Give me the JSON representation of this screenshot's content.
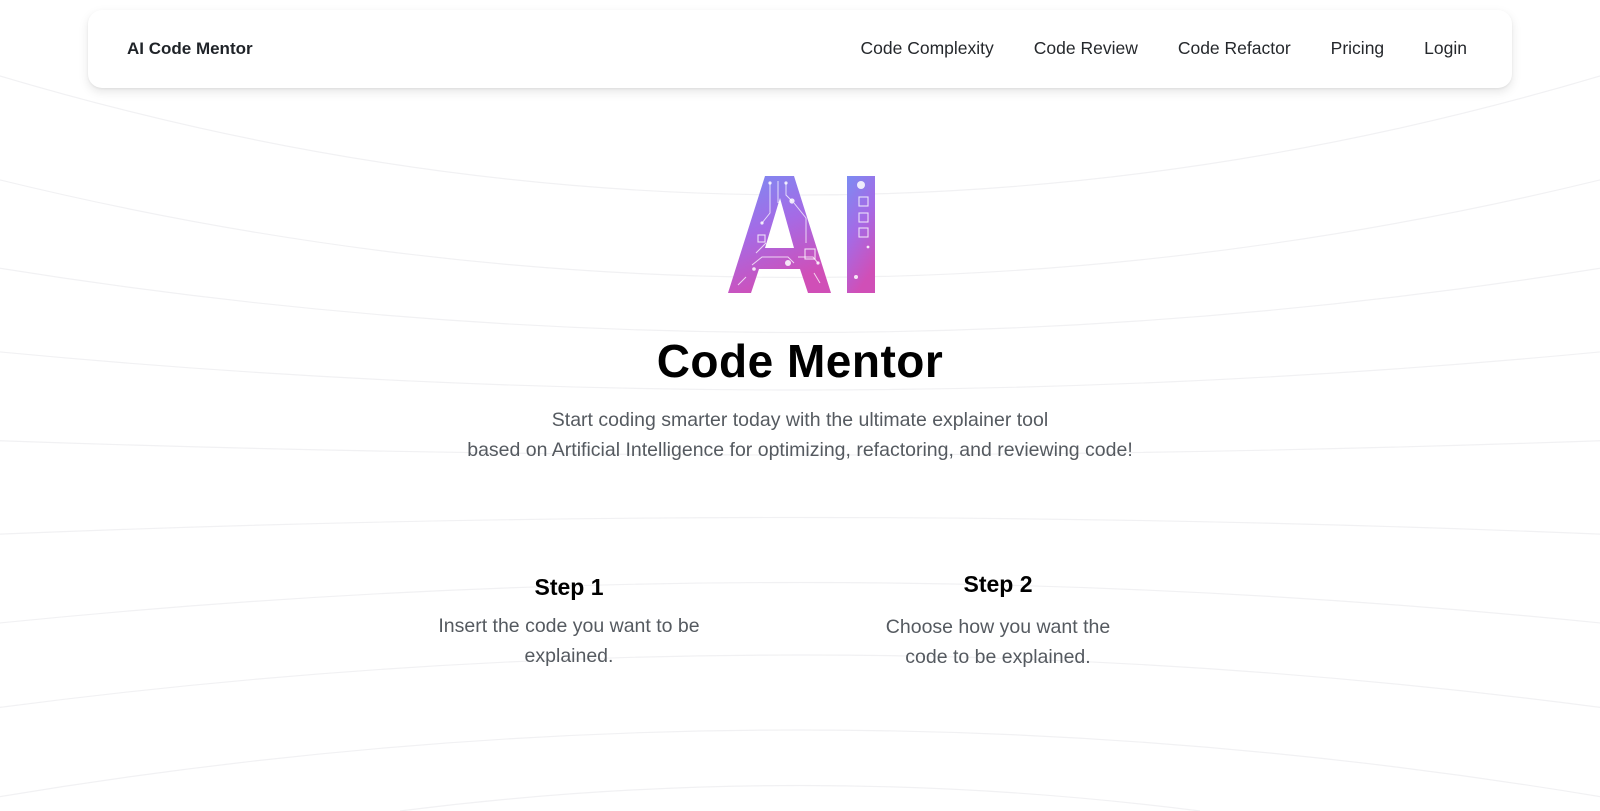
{
  "nav": {
    "brand": "AI Code Mentor",
    "links": [
      "Code Complexity",
      "Code Review",
      "Code Refactor",
      "Pricing",
      "Login"
    ]
  },
  "hero": {
    "logo_text": "AI",
    "title": "Code Mentor",
    "subtitle_line1": "Start coding smarter today with the ultimate explainer tool",
    "subtitle_line2": "based on Artificial Intelligence for optimizing, refactoring, and reviewing code!"
  },
  "steps": [
    {
      "title": "Step 1",
      "description": "Insert the code you want to be explained."
    },
    {
      "title": "Step 2",
      "description": "Choose how you want the code to be explained."
    }
  ],
  "colors": {
    "logo_gradient_top": "#7b8cf2",
    "logo_gradient_mid": "#a46be6",
    "logo_gradient_bottom": "#d04fb7",
    "text_muted": "#555a60",
    "background": "#ffffff"
  }
}
